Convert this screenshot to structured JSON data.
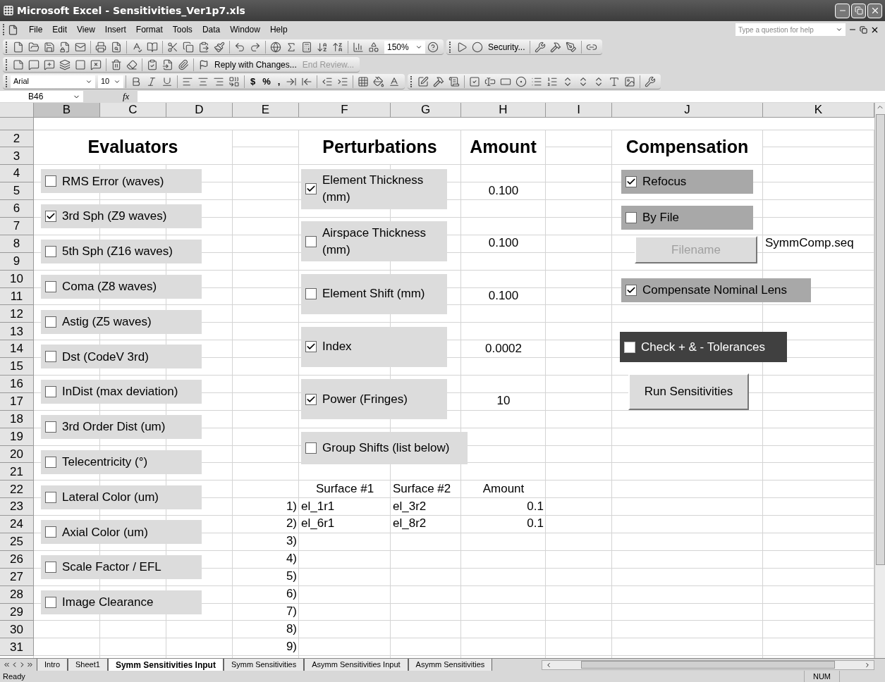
{
  "window": {
    "title": "Microsoft Excel - Sensitivities_Ver1p7.xls"
  },
  "menu": [
    "File",
    "Edit",
    "View",
    "Insert",
    "Format",
    "Tools",
    "Data",
    "Window",
    "Help"
  ],
  "help_box": {
    "placeholder": "Type a question for help"
  },
  "standard_toolbar": {
    "zoom": "150%"
  },
  "macro_toolbar": {
    "security": "Security..."
  },
  "reviewing_toolbar": {
    "reply": "Reply with Changes...",
    "end_review": "End Review..."
  },
  "formatting_toolbar": {
    "font": "Arial",
    "size": "10",
    "number_formats": [
      "$",
      "%",
      ","
    ]
  },
  "formula_bar": {
    "name_box": "B46",
    "fx": "fx"
  },
  "columns": [
    {
      "label": "B",
      "selected": true
    },
    {
      "label": "C",
      "selected": false
    },
    {
      "label": "D",
      "selected": false
    },
    {
      "label": "E",
      "selected": false
    },
    {
      "label": "F",
      "selected": false
    },
    {
      "label": "G",
      "selected": false
    },
    {
      "label": "H",
      "selected": false
    },
    {
      "label": "I",
      "selected": false
    },
    {
      "label": "J",
      "selected": false
    },
    {
      "label": "K",
      "selected": false
    }
  ],
  "rows": [
    "2",
    "3",
    "4",
    "5",
    "6",
    "7",
    "8",
    "9",
    "10",
    "11",
    "12",
    "13",
    "14",
    "15",
    "16",
    "17",
    "18",
    "19",
    "20",
    "21",
    "22",
    "23",
    "24",
    "25",
    "26",
    "27",
    "28",
    "29",
    "30",
    "31"
  ],
  "titles": {
    "evaluators": "Evaluators",
    "perturbations": "Perturbations",
    "amount": "Amount",
    "compensation": "Compensation"
  },
  "evaluators": [
    {
      "label": "RMS Error (waves)",
      "checked": false
    },
    {
      "label": "3rd Sph (Z9 waves)",
      "checked": true
    },
    {
      "label": "5th Sph (Z16 waves)",
      "checked": false
    },
    {
      "label": "Coma (Z8 waves)",
      "checked": false
    },
    {
      "label": "Astig (Z5 waves)",
      "checked": false
    },
    {
      "label": "Dst (CodeV 3rd)",
      "checked": false
    },
    {
      "label": "InDist (max deviation)",
      "checked": false
    },
    {
      "label": "3rd Order Dist (um)",
      "checked": false
    },
    {
      "label": "Telecentricity (°)",
      "checked": false
    },
    {
      "label": "Lateral Color (um)",
      "checked": false
    },
    {
      "label": "Axial Color (um)",
      "checked": false
    },
    {
      "label": "Scale Factor / EFL",
      "checked": false
    },
    {
      "label": "Image Clearance",
      "checked": false
    }
  ],
  "perturbations": [
    {
      "label": "Element Thickness (mm)",
      "checked": true,
      "amount": "0.100"
    },
    {
      "label": "Airspace Thickness (mm)",
      "checked": false,
      "amount": "0.100"
    },
    {
      "label": "Element Shift (mm)",
      "checked": false,
      "amount": "0.100"
    },
    {
      "label": "Index",
      "checked": true,
      "amount": "0.0002"
    },
    {
      "label": "Power (Fringes)",
      "checked": true,
      "amount": "10"
    },
    {
      "label": "Group Shifts (list below)",
      "checked": false
    }
  ],
  "group_table": {
    "columns": [
      "Surface #1",
      "Surface #2",
      "Amount"
    ],
    "indices": [
      "1)",
      "2)",
      "3)",
      "4)",
      "5)",
      "6)",
      "7)",
      "8)",
      "9)"
    ],
    "rows": [
      {
        "surface_1": "el_1r1",
        "surface_2": "el_3r2",
        "amount": "0.1"
      },
      {
        "surface_1": "el_6r1",
        "surface_2": "el_8r2",
        "amount": "0.1"
      }
    ]
  },
  "compensation": {
    "refocus": {
      "label": "Refocus",
      "checked": true
    },
    "by_file": {
      "label": "By File",
      "checked": false
    },
    "filename_button": {
      "label": "Filename",
      "disabled": true
    },
    "filename": "SymmComp.seq",
    "compensate_nominal": {
      "label": "Compensate Nominal Lens",
      "checked": true
    },
    "check_tolerances": {
      "label": "Check + & - Tolerances",
      "checked": false
    },
    "run_button": "Run Sensitivities"
  },
  "sheet_tabs": [
    {
      "label": "Intro",
      "selected": false
    },
    {
      "label": "Sheet1",
      "selected": false
    },
    {
      "label": "Symm Sensitivities Input",
      "selected": true
    },
    {
      "label": "Symm Sensitivities",
      "selected": false
    },
    {
      "label": "Asymm Sensitivities Input",
      "selected": false
    },
    {
      "label": "Asymm Sensitivities",
      "selected": false
    }
  ],
  "status_bar": {
    "status": "Ready",
    "num_lock": "NUM"
  }
}
